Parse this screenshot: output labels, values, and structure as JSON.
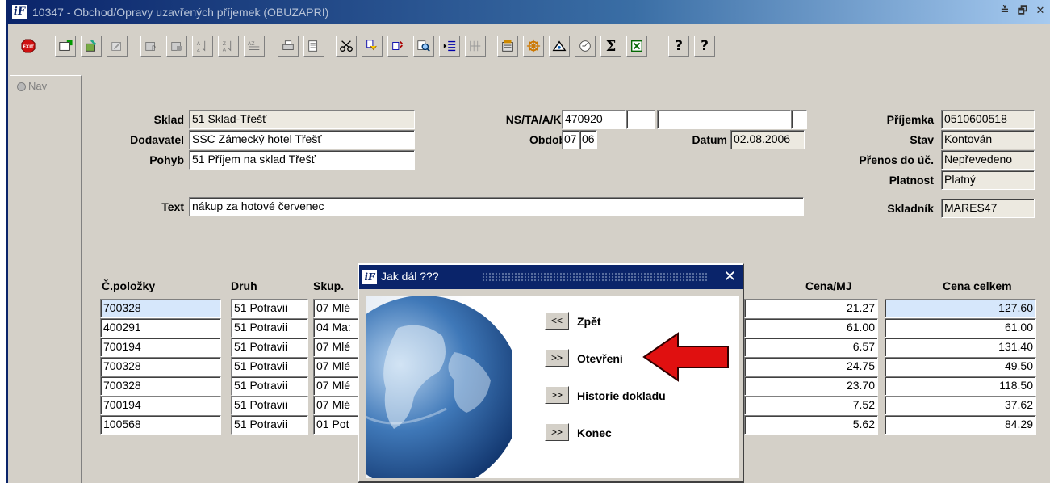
{
  "window": {
    "title": "10347 - Obchod/Opravy uzavřených příjemek (OBUZAPRI)",
    "logo": "iF",
    "controls": [
      "≚",
      "🗗",
      "✕"
    ]
  },
  "nav": {
    "label": "Nav"
  },
  "header": {
    "sklad_label": "Sklad",
    "sklad_value": "51 Sklad-Třešť",
    "dodavatel_label": "Dodavatel",
    "dodavatel_value": "SSC Zámecký hotel Třešť",
    "pohyb_label": "Pohyb",
    "pohyb_value": "51 Příjem na sklad Třešť",
    "text_label": "Text",
    "text_value": "nákup za hotové červenec",
    "ns_label": "NS/TA/A/KP",
    "ns_value": "470920",
    "obdobi_label": "Období",
    "obdobi_month": "07",
    "obdobi_year": "06",
    "datum_label": "Datum",
    "datum_value": "02.08.2006",
    "prijemka_label": "Příjemka",
    "prijemka_value": "0510600518",
    "stav_label": "Stav",
    "stav_value": "Kontován",
    "prenos_label": "Přenos do úč.",
    "prenos_value": "Nepřevedeno",
    "platnost_label": "Platnost",
    "platnost_value": "Platný",
    "skladnik_label": "Skladník",
    "skladnik_value": "MARES47"
  },
  "table": {
    "headers": {
      "polozka": "Č.položky",
      "druh": "Druh",
      "skup": "Skup.",
      "cena_mj": "Cena/MJ",
      "cena_celkem": "Cena celkem"
    },
    "rows": [
      {
        "polozka": "700328",
        "druh": "51 Potravii",
        "skup": "07 Mlé",
        "cena_mj": "21.27",
        "cena_celkem": "127.60"
      },
      {
        "polozka": "400291",
        "druh": "51 Potravii",
        "skup": "04 Ma:",
        "cena_mj": "61.00",
        "cena_celkem": "61.00"
      },
      {
        "polozka": "700194",
        "druh": "51 Potravii",
        "skup": "07 Mlé",
        "cena_mj": "6.57",
        "cena_celkem": "131.40"
      },
      {
        "polozka": "700328",
        "druh": "51 Potravii",
        "skup": "07 Mlé",
        "cena_mj": "24.75",
        "cena_celkem": "49.50"
      },
      {
        "polozka": "700328",
        "druh": "51 Potravii",
        "skup": "07 Mlé",
        "cena_mj": "23.70",
        "cena_celkem": "118.50"
      },
      {
        "polozka": "700194",
        "druh": "51 Potravii",
        "skup": "07 Mlé",
        "cena_mj": "7.52",
        "cena_celkem": "37.62"
      },
      {
        "polozka": "100568",
        "druh": "51 Potravii",
        "skup": "01 Pot",
        "cena_mj": "5.62",
        "cena_celkem": "84.29"
      }
    ]
  },
  "dialog": {
    "title": "Jak dál ???",
    "close": "✕",
    "back_btn": "<<",
    "back_label": "Zpět",
    "open_btn": ">>",
    "open_label": "Otevření",
    "history_btn": ">>",
    "history_label": "Historie dokladu",
    "end_btn": ">>",
    "end_label": "Konec"
  },
  "toolbar": {
    "exit_label": "EXIT",
    "sigma": "Σ",
    "help_q": "?",
    "help2_q": "?"
  },
  "colors": {
    "arrow": "#e01010",
    "title_bar": "#0a246a",
    "highlight_row": "#d6e7fb"
  }
}
